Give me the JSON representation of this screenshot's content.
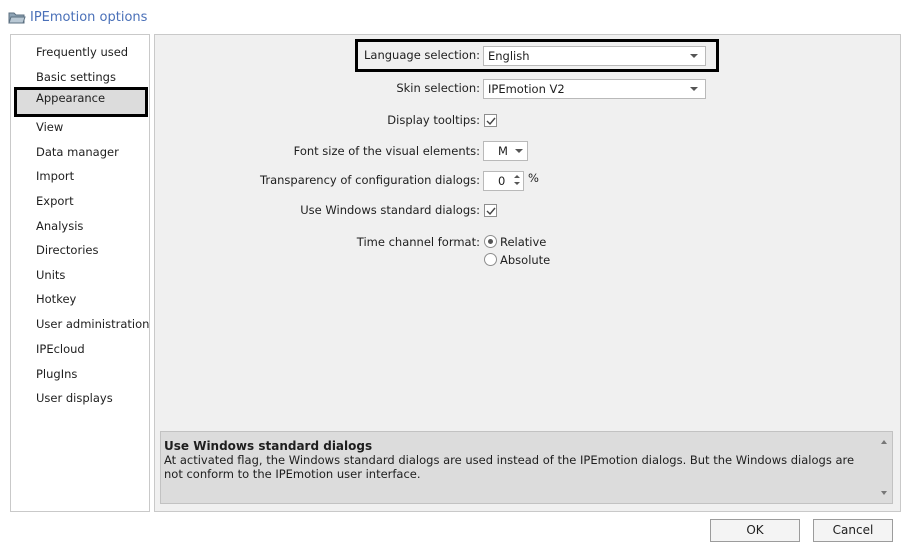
{
  "window": {
    "title": "IPEmotion options",
    "icon": "folder-open-icon"
  },
  "sidebar": {
    "items": [
      {
        "label": "Frequently used"
      },
      {
        "label": "Basic settings"
      },
      {
        "label": "Appearance",
        "selected": true
      },
      {
        "label": "View"
      },
      {
        "label": "Data manager"
      },
      {
        "label": "Import"
      },
      {
        "label": "Export"
      },
      {
        "label": "Analysis"
      },
      {
        "label": "Directories"
      },
      {
        "label": "Units"
      },
      {
        "label": "Hotkey"
      },
      {
        "label": "User administration"
      },
      {
        "label": "IPEcloud"
      },
      {
        "label": "PlugIns"
      },
      {
        "label": "User displays"
      }
    ]
  },
  "settings": {
    "language": {
      "label": "Language selection:",
      "value": "English"
    },
    "skin": {
      "label": "Skin selection:",
      "value": "IPEmotion V2"
    },
    "tooltips": {
      "label": "Display tooltips:",
      "checked": true
    },
    "font_size": {
      "label": "Font size of the visual elements:",
      "value": "M"
    },
    "transparency": {
      "label": "Transparency of configuration dialogs:",
      "value": "0",
      "unit": "%"
    },
    "win_dialogs": {
      "label": "Use Windows standard dialogs:",
      "checked": true
    },
    "time_format": {
      "label": "Time channel format:",
      "options": [
        {
          "label": "Relative",
          "selected": true
        },
        {
          "label": "Absolute",
          "selected": false
        }
      ]
    }
  },
  "help": {
    "title": "Use Windows standard dialogs",
    "body": "At activated flag, the Windows standard dialogs are used instead of the IPEmotion dialogs. But the Windows dialogs are not conform to the IPEmotion user interface."
  },
  "buttons": {
    "ok": "OK",
    "cancel": "Cancel"
  }
}
